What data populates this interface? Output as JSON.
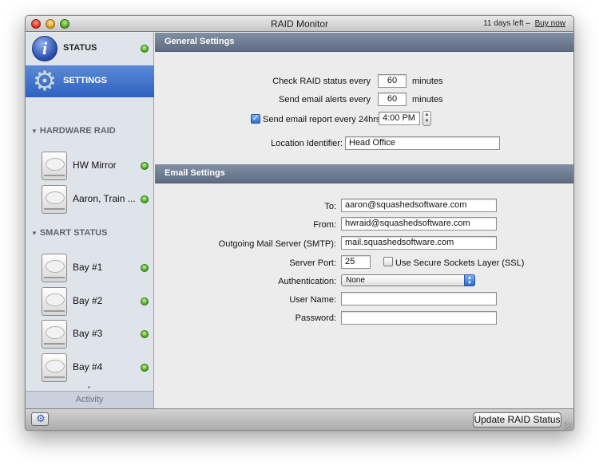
{
  "window": {
    "title": "RAID Monitor",
    "trial_text": "11 days left –",
    "buy_label": "Buy now"
  },
  "sidebar": {
    "status_label": "STATUS",
    "settings_label": "SETTINGS",
    "hardware_raid_title": "HARDWARE RAID",
    "hardware_raid_items": [
      {
        "label": "HW Mirror",
        "status": "ok"
      },
      {
        "label": "Aaron, Train ...",
        "status": "ok"
      }
    ],
    "smart_status_title": "SMART STATUS",
    "smart_items": [
      {
        "label": "Bay #1",
        "status": "ok"
      },
      {
        "label": "Bay #2",
        "status": "ok"
      },
      {
        "label": "Bay #3",
        "status": "ok"
      },
      {
        "label": "Bay #4",
        "status": "ok"
      }
    ],
    "activity_label": "Activity"
  },
  "general_settings": {
    "header": "General Settings",
    "check_label": "Check RAID status every",
    "check_value": "60",
    "check_unit": "minutes",
    "alerts_label": "Send email alerts every",
    "alerts_value": "60",
    "alerts_unit": "minutes",
    "report_checked": true,
    "report_label": "Send email report every 24hrs at",
    "report_time": "4:00 PM",
    "location_label": "Location Identifier:",
    "location_value": "Head Office"
  },
  "email_settings": {
    "header": "Email Settings",
    "to_label": "To:",
    "to_value": "aaron@squashedsoftware.com",
    "from_label": "From:",
    "from_value": "hwraid@squashedsoftware.com",
    "smtp_label": "Outgoing Mail Server (SMTP):",
    "smtp_value": "mail.squashedsoftware.com",
    "port_label": "Server Port:",
    "port_value": "25",
    "ssl_checked": false,
    "ssl_label": "Use Secure Sockets Layer (SSL)",
    "auth_label": "Authentication:",
    "auth_value": "None",
    "username_label": "User Name:",
    "username_value": "",
    "password_label": "Password:",
    "password_value": ""
  },
  "bottom": {
    "update_label": "Update RAID Status"
  },
  "colors": {
    "selection": "#3a6fcb",
    "status_ok": "#39a012",
    "section_header": "#6b7a90"
  }
}
